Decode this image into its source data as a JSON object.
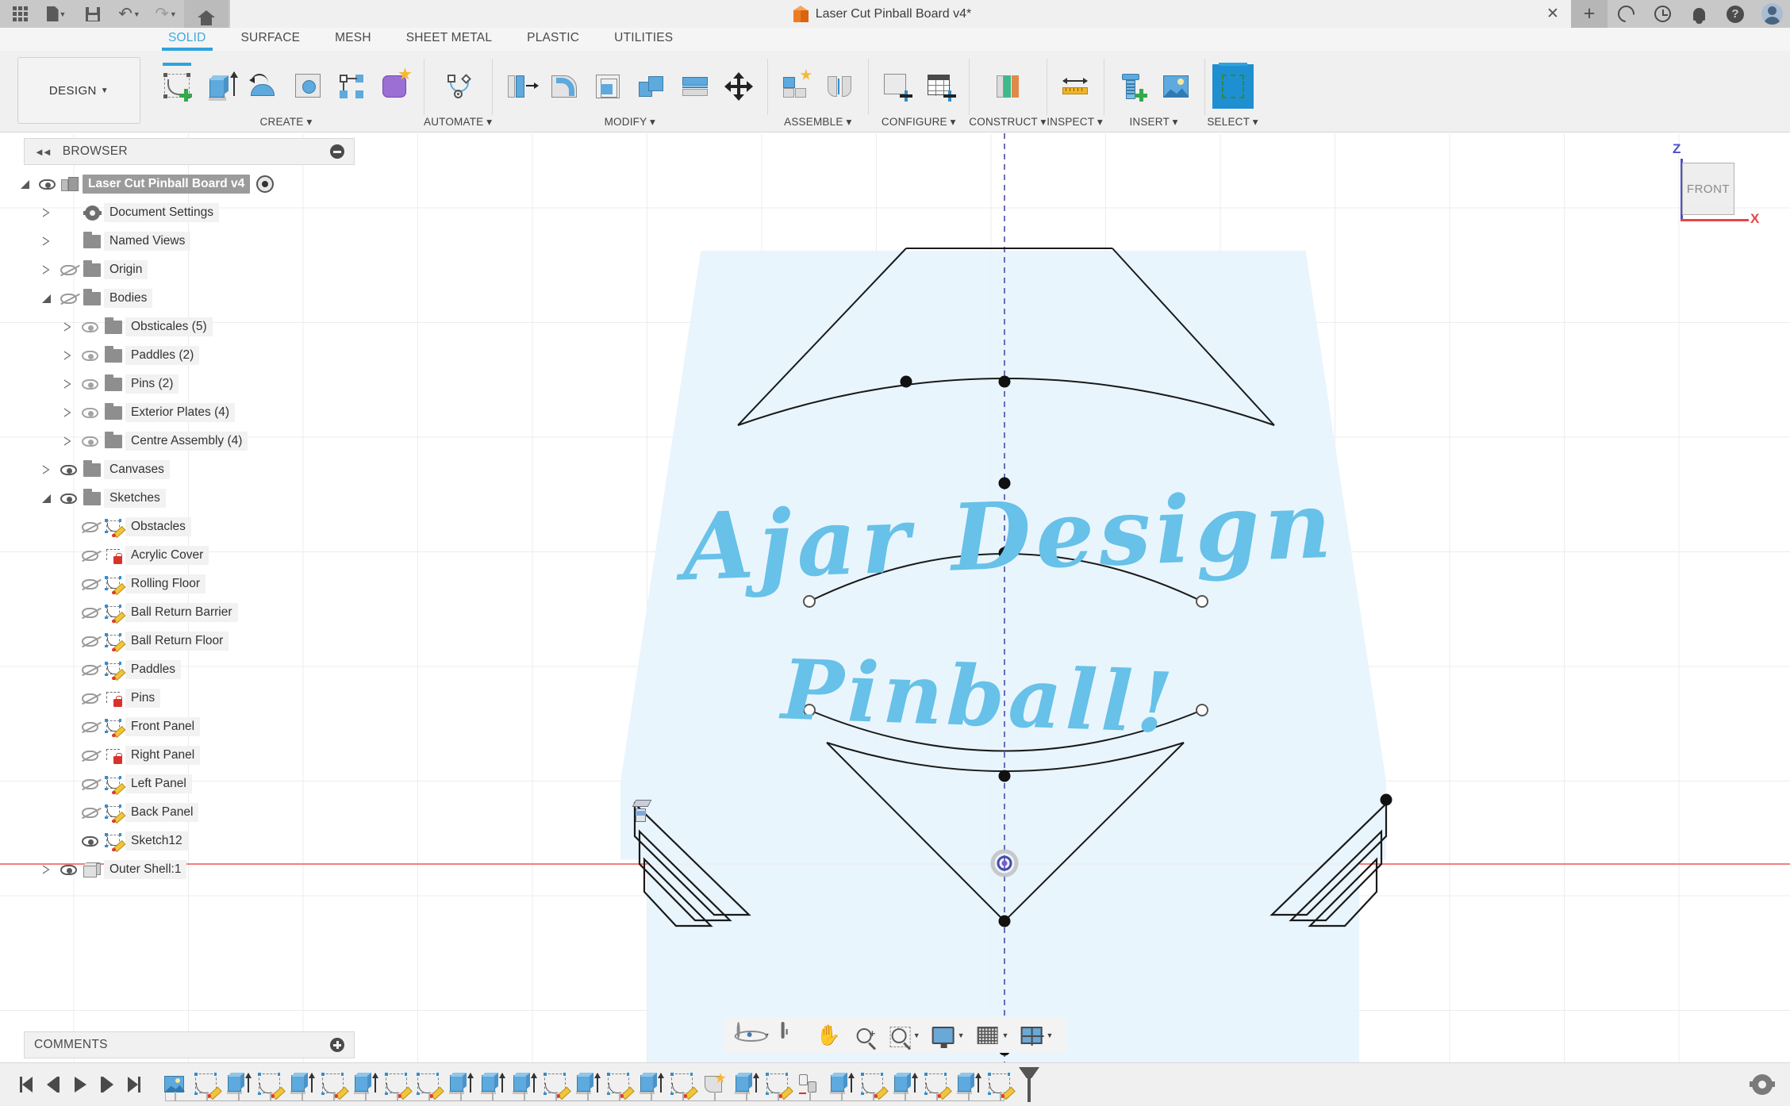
{
  "titlebar": {
    "quick_access": [
      {
        "name": "app-grid-icon",
        "label": "Show Data Panel"
      },
      {
        "name": "file-icon",
        "label": "File",
        "caret": true
      },
      {
        "name": "save-icon",
        "label": "Save"
      },
      {
        "name": "undo-icon",
        "label": "Undo",
        "caret": true
      },
      {
        "name": "redo-icon",
        "label": "Redo",
        "caret": true
      },
      {
        "name": "home-icon",
        "label": "Home"
      }
    ],
    "document_title": "Laser Cut Pinball Board v4*",
    "right_icons": [
      {
        "name": "close-icon",
        "label": "Close"
      },
      {
        "name": "plus-icon",
        "label": "New"
      },
      {
        "name": "job-status-icon",
        "label": "Job Status"
      },
      {
        "name": "history-icon",
        "label": "Recent"
      },
      {
        "name": "notification-bell-icon",
        "label": "Notifications"
      },
      {
        "name": "help-icon",
        "label": "Help"
      },
      {
        "name": "avatar-icon",
        "label": "Account"
      }
    ]
  },
  "ribbon": {
    "workspace": "DESIGN",
    "tabs": [
      {
        "label": "SOLID",
        "active": true
      },
      {
        "label": "SURFACE",
        "active": false
      },
      {
        "label": "MESH",
        "active": false
      },
      {
        "label": "SHEET METAL",
        "active": false
      },
      {
        "label": "PLASTIC",
        "active": false
      },
      {
        "label": "UTILITIES",
        "active": false
      }
    ],
    "panels": [
      {
        "label": "CREATE ▾",
        "tools": [
          "create-sketch",
          "extrude",
          "revolve",
          "hole",
          "pattern",
          "form"
        ]
      },
      {
        "label": "AUTOMATE ▾",
        "tools": [
          "automate"
        ]
      },
      {
        "label": "MODIFY ▾",
        "tools": [
          "press-pull",
          "fillet",
          "shell",
          "combine",
          "split-face",
          "move-copy"
        ]
      },
      {
        "label": "ASSEMBLE ▾",
        "tools": [
          "new-component",
          "joint"
        ]
      },
      {
        "label": "CONFIGURE ▾",
        "tools": [
          "configure-component",
          "configuration-table"
        ]
      },
      {
        "label": "CONSTRUCT ▾",
        "tools": [
          "offset-plane"
        ]
      },
      {
        "label": "INSPECT ▾",
        "tools": [
          "measure"
        ]
      },
      {
        "label": "INSERT ▾",
        "tools": [
          "insert-mcmaster",
          "insert-canvas"
        ]
      },
      {
        "label": "SELECT ▾",
        "tools": [
          "select"
        ]
      }
    ]
  },
  "browser": {
    "title": "BROWSER",
    "collapse_icon": "collapse-left-icon",
    "minimize_icon": "minimize-icon",
    "tree": [
      {
        "label": "Laser Cut Pinball Board v4",
        "indent": 0,
        "icon": "component-icon",
        "expander": "open",
        "eye": "on",
        "selected": true,
        "radio": true
      },
      {
        "label": "Document Settings",
        "indent": 1,
        "icon": "gear-icon",
        "expander": "closed",
        "eye": "none"
      },
      {
        "label": "Named Views",
        "indent": 1,
        "icon": "folder-icon",
        "expander": "closed",
        "eye": "none"
      },
      {
        "label": "Origin",
        "indent": 1,
        "icon": "folder-icon",
        "expander": "closed",
        "eye": "off"
      },
      {
        "label": "Bodies",
        "indent": 1,
        "icon": "folder-icon",
        "expander": "open",
        "eye": "off"
      },
      {
        "label": "Obsticales (5)",
        "indent": 2,
        "icon": "folder-icon",
        "expander": "closed",
        "eye": "on-dim"
      },
      {
        "label": "Paddles (2)",
        "indent": 2,
        "icon": "folder-icon",
        "expander": "closed",
        "eye": "on-dim"
      },
      {
        "label": "Pins (2)",
        "indent": 2,
        "icon": "folder-icon",
        "expander": "closed",
        "eye": "on-dim"
      },
      {
        "label": "Exterior Plates (4)",
        "indent": 2,
        "icon": "folder-icon",
        "expander": "closed",
        "eye": "on-dim"
      },
      {
        "label": "Centre Assembly (4)",
        "indent": 2,
        "icon": "folder-icon",
        "expander": "closed",
        "eye": "on-dim"
      },
      {
        "label": "Canvases",
        "indent": 1,
        "icon": "folder-icon",
        "expander": "closed",
        "eye": "on"
      },
      {
        "label": "Sketches",
        "indent": 1,
        "icon": "folder-icon",
        "expander": "open",
        "eye": "on"
      },
      {
        "label": "Obstacles",
        "indent": 2,
        "icon": "sketch-icon",
        "expander": "none",
        "eye": "off"
      },
      {
        "label": "Acrylic Cover",
        "indent": 2,
        "icon": "sketch-locked-icon",
        "expander": "none",
        "eye": "off"
      },
      {
        "label": "Rolling Floor",
        "indent": 2,
        "icon": "sketch-icon",
        "expander": "none",
        "eye": "off"
      },
      {
        "label": "Ball Return Barrier",
        "indent": 2,
        "icon": "sketch-icon",
        "expander": "none",
        "eye": "off"
      },
      {
        "label": "Ball Return Floor",
        "indent": 2,
        "icon": "sketch-icon",
        "expander": "none",
        "eye": "off"
      },
      {
        "label": "Paddles",
        "indent": 2,
        "icon": "sketch-icon",
        "expander": "none",
        "eye": "off"
      },
      {
        "label": "Pins",
        "indent": 2,
        "icon": "sketch-locked-icon",
        "expander": "none",
        "eye": "off"
      },
      {
        "label": "Front Panel",
        "indent": 2,
        "icon": "sketch-icon",
        "expander": "none",
        "eye": "off"
      },
      {
        "label": "Right Panel",
        "indent": 2,
        "icon": "sketch-locked-icon",
        "expander": "none",
        "eye": "off"
      },
      {
        "label": "Left Panel",
        "indent": 2,
        "icon": "sketch-icon",
        "expander": "none",
        "eye": "off"
      },
      {
        "label": "Back Panel",
        "indent": 2,
        "icon": "sketch-icon",
        "expander": "none",
        "eye": "off"
      },
      {
        "label": "Sketch12",
        "indent": 2,
        "icon": "sketch-icon",
        "expander": "none",
        "eye": "on"
      },
      {
        "label": "Outer Shell:1",
        "indent": 1,
        "icon": "body-icon",
        "expander": "closed",
        "eye": "on"
      }
    ]
  },
  "comments": {
    "title": "COMMENTS",
    "add_icon": "add-comment-icon"
  },
  "canvas": {
    "logo_line1": "Ajar Design",
    "logo_line2": "Pinball!",
    "logo_color": "#67c1e8",
    "board_fill": "#e8f4fd",
    "sketch_line_color": "#1a1a1a",
    "x_axis_color": "#f08080",
    "construction_axis_color": "#4a4aa8",
    "viewcube": {
      "face_label": "FRONT",
      "z_label": "Z",
      "x_label": "X",
      "z_color": "#5050c8",
      "x_color": "#e84545"
    },
    "navbar": [
      {
        "name": "orbit-icon",
        "caret": true
      },
      {
        "name": "look-at-icon",
        "caret": false
      },
      {
        "name": "pan-icon",
        "caret": false
      },
      {
        "name": "zoom-icon",
        "caret": false
      },
      {
        "name": "zoom-window-icon",
        "caret": true
      },
      {
        "name": "display-settings-icon",
        "caret": true
      },
      {
        "name": "grid-snaps-icon",
        "caret": true
      },
      {
        "name": "viewports-icon",
        "caret": true
      }
    ]
  },
  "timeline": {
    "playback": [
      {
        "name": "go-to-beginning-icon"
      },
      {
        "name": "step-back-icon"
      },
      {
        "name": "play-icon"
      },
      {
        "name": "step-forward-icon"
      },
      {
        "name": "go-to-end-icon"
      }
    ],
    "features": [
      "canvas",
      "sketch",
      "extrude",
      "sketch",
      "extrude",
      "sketch",
      "extrude",
      "sketch",
      "sketch",
      "extrude",
      "extrude",
      "extrude",
      "sketch",
      "extrude",
      "sketch",
      "extrude",
      "sketch",
      "new-component",
      "extrude",
      "sketch",
      "copy-paste",
      "extrude",
      "sketch",
      "extrude",
      "sketch",
      "extrude",
      "sketch"
    ],
    "end_marker": "timeline-end-marker",
    "settings_icon": "timeline-settings-icon"
  }
}
